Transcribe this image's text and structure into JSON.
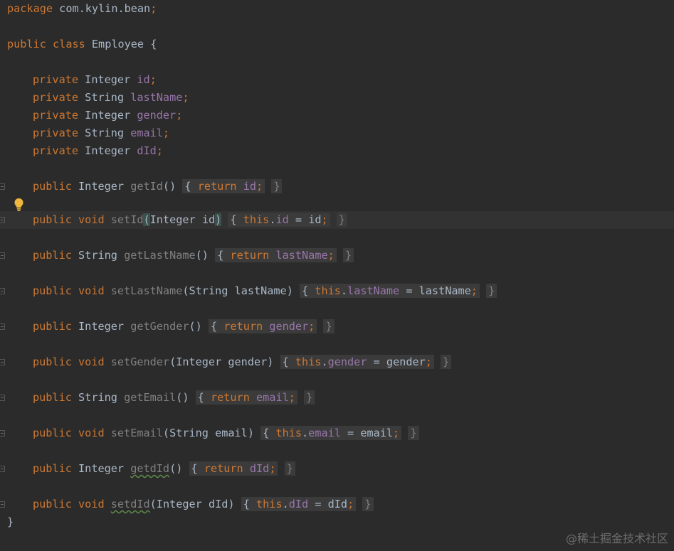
{
  "file": {
    "package_kw": "package",
    "package_name": "com.kylin.bean",
    "class_decl": {
      "public_kw": "public",
      "class_kw": "class",
      "name": "Employee",
      "open_brace": "{"
    },
    "fields": [
      {
        "modifier": "private",
        "type": "Integer",
        "name": "id"
      },
      {
        "modifier": "private",
        "type": "String",
        "name": "lastName"
      },
      {
        "modifier": "private",
        "type": "Integer",
        "name": "gender"
      },
      {
        "modifier": "private",
        "type": "String",
        "name": "email"
      },
      {
        "modifier": "private",
        "type": "Integer",
        "name": "dId"
      }
    ],
    "methods": [
      {
        "modifier": "public",
        "ret": "Integer",
        "name": "getId",
        "params": "()",
        "kw": "return",
        "body_field": "id",
        "kind": "getter"
      },
      {
        "modifier": "public",
        "ret": "void",
        "name": "setId",
        "param_type": "Integer",
        "param_name": "id",
        "kw": "this",
        "body_field": "id",
        "assign_value": "id",
        "kind": "setter"
      },
      {
        "modifier": "public",
        "ret": "String",
        "name": "getLastName",
        "params": "()",
        "kw": "return",
        "body_field": "lastName",
        "kind": "getter"
      },
      {
        "modifier": "public",
        "ret": "void",
        "name": "setLastName",
        "param_type": "String",
        "param_name": "lastName",
        "kw": "this",
        "body_field": "lastName",
        "assign_value": "lastName",
        "kind": "setter"
      },
      {
        "modifier": "public",
        "ret": "Integer",
        "name": "getGender",
        "params": "()",
        "kw": "return",
        "body_field": "gender",
        "kind": "getter"
      },
      {
        "modifier": "public",
        "ret": "void",
        "name": "setGender",
        "param_type": "Integer",
        "param_name": "gender",
        "kw": "this",
        "body_field": "gender",
        "assign_value": "gender",
        "kind": "setter"
      },
      {
        "modifier": "public",
        "ret": "String",
        "name": "getEmail",
        "params": "()",
        "kw": "return",
        "body_field": "email",
        "kind": "getter"
      },
      {
        "modifier": "public",
        "ret": "void",
        "name": "setEmail",
        "param_type": "String",
        "param_name": "email",
        "kw": "this",
        "body_field": "email",
        "assign_value": "email",
        "kind": "setter"
      },
      {
        "modifier": "public",
        "ret": "Integer",
        "name": "getdId",
        "params": "()",
        "kw": "return",
        "body_field": "dId",
        "kind": "getter"
      },
      {
        "modifier": "public",
        "ret": "void",
        "name": "setdId",
        "param_type": "Integer",
        "param_name": "dId",
        "kw": "this",
        "body_field": "dId",
        "assign_value": "dId",
        "kind": "setter"
      }
    ],
    "close_brace": "}"
  },
  "watermark": "@稀土掘金技术社区",
  "icons": {
    "intention": "lightbulb-icon",
    "fold": "fold-marker-icon"
  },
  "colors": {
    "background": "#2b2b2b",
    "current_line": "#323232",
    "keyword": "#cc7832",
    "field": "#9876aa",
    "text": "#a9b7c6"
  }
}
